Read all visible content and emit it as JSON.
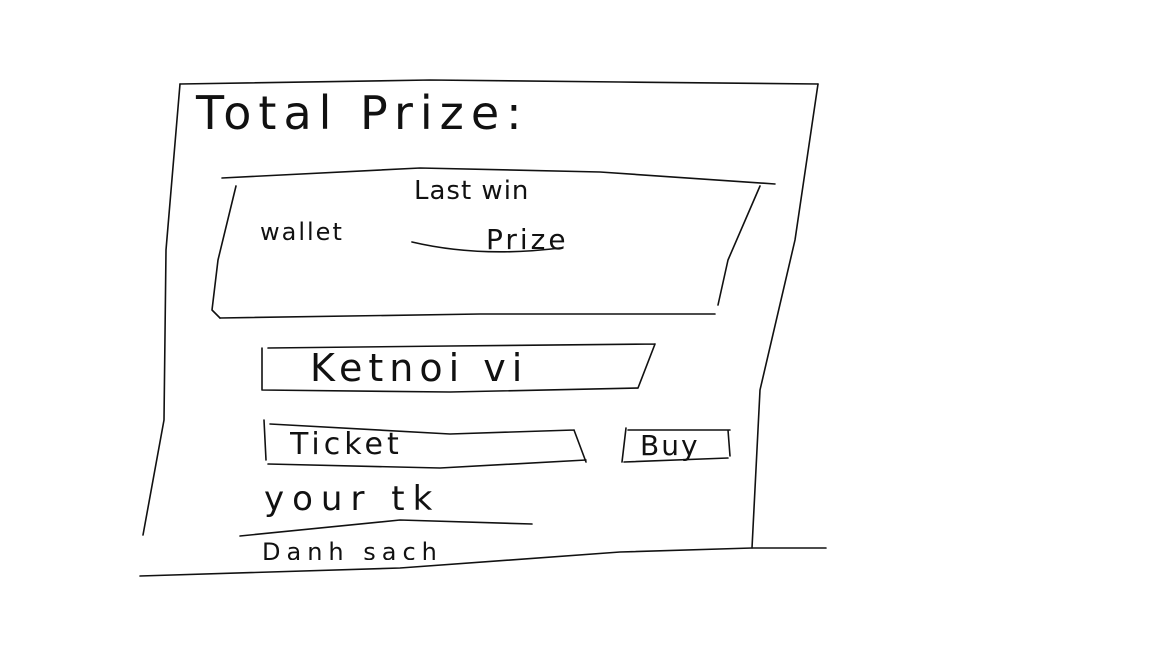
{
  "header": {
    "title": "Total Prize:"
  },
  "last_win_panel": {
    "title": "Last win",
    "wallet_label": "wallet",
    "prize_label": "Prize"
  },
  "connect": {
    "label": "Ketnoi vi"
  },
  "ticket": {
    "placeholder": "Ticket",
    "buy_label": "Buy"
  },
  "your_tickets": {
    "label": "your tk"
  },
  "history": {
    "label": "Danh sach"
  }
}
